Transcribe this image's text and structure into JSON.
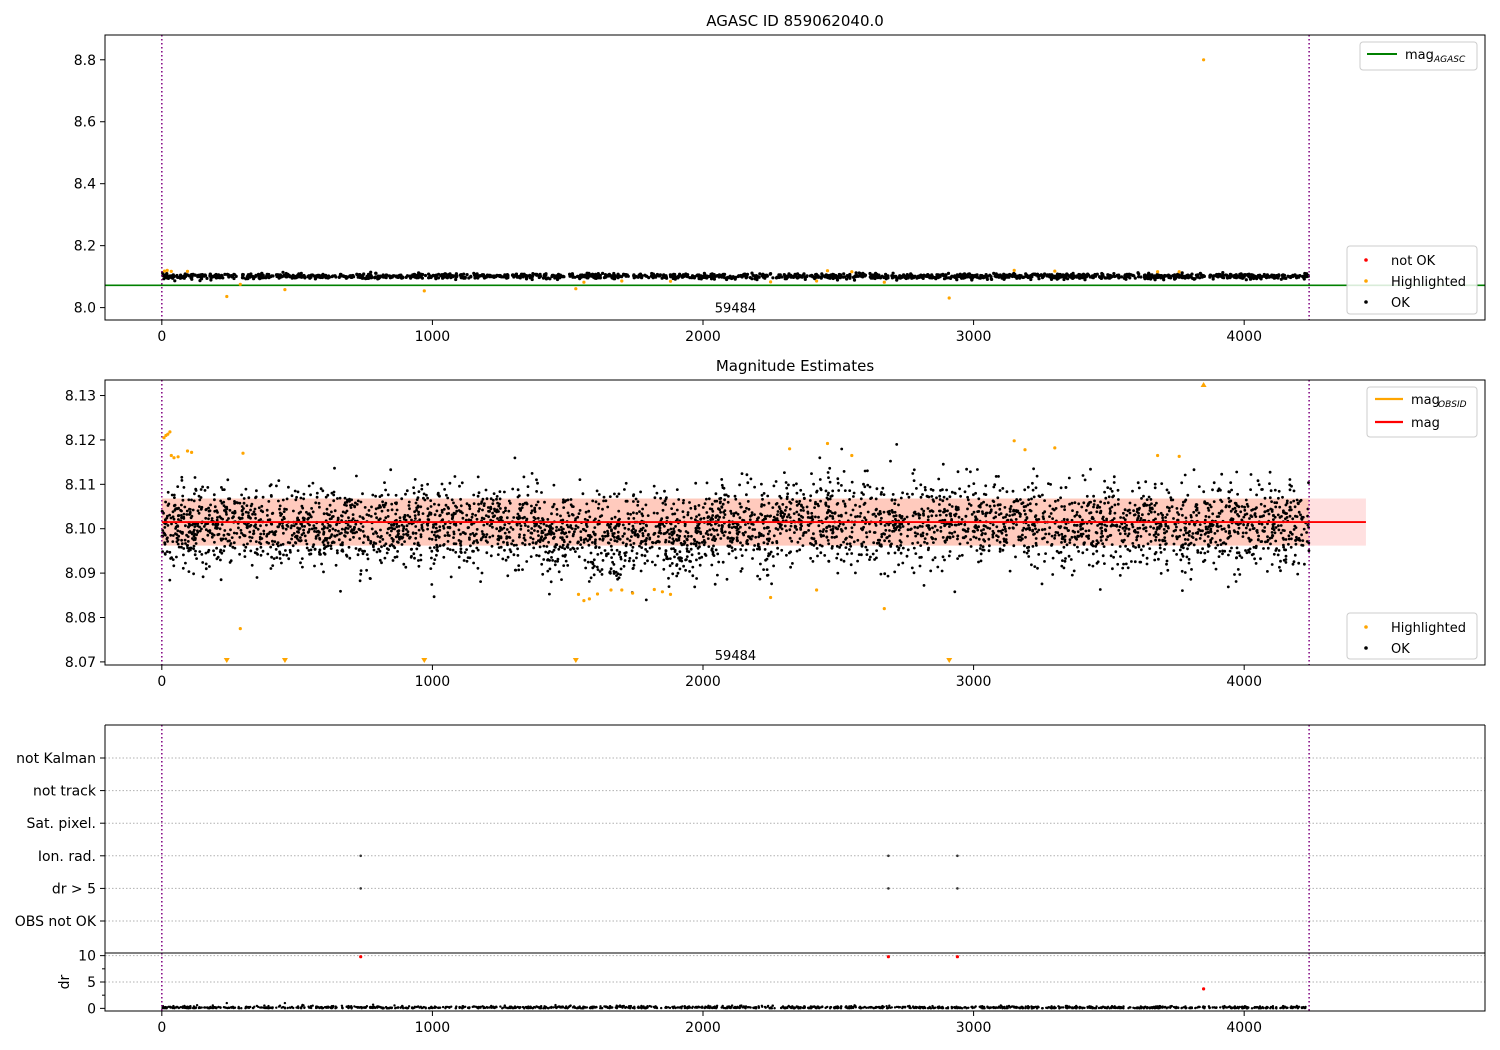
{
  "colors": {
    "ok": "#000000",
    "highlighted": "#ffa500",
    "not_ok": "#ff0000",
    "mag_agasc": "#008000",
    "mag_obsid": "#ffa500",
    "mag": "#ff0000",
    "obs_boundary": "#800080",
    "band_fill": "#ffcccc"
  },
  "chart_data": [
    {
      "type": "scatter",
      "title": "AGASC ID 859062040.0",
      "xlim": [
        -210,
        4890
      ],
      "ylim": [
        7.96,
        8.88
      ],
      "xticks": [
        0,
        1000,
        2000,
        3000,
        4000
      ],
      "yticks": [
        8.0,
        8.2,
        8.4,
        8.6,
        8.8
      ],
      "ytick_labels": [
        "8.0",
        "8.2",
        "8.4",
        "8.6",
        "8.8"
      ],
      "mag_agasc": 8.072,
      "obs_boundaries": [
        0,
        4240
      ],
      "obs_label": {
        "text": "59484",
        "x": 2120,
        "y": 8.0
      },
      "series_ok_band": {
        "x_start": 0,
        "x_end": 4240,
        "center": 8.101,
        "spread": 0.007
      },
      "highlighted_points": [
        [
          10,
          8.118
        ],
        [
          20,
          8.12
        ],
        [
          35,
          8.117
        ],
        [
          95,
          8.117
        ],
        [
          240,
          8.036
        ],
        [
          290,
          8.075
        ],
        [
          455,
          8.058
        ],
        [
          970,
          8.054
        ],
        [
          1530,
          8.061
        ],
        [
          1560,
          8.082
        ],
        [
          1700,
          8.086
        ],
        [
          1880,
          8.085
        ],
        [
          2250,
          8.083
        ],
        [
          2420,
          8.086
        ],
        [
          2460,
          8.119
        ],
        [
          2550,
          8.116
        ],
        [
          2670,
          8.082
        ],
        [
          2910,
          8.031
        ],
        [
          3150,
          8.12
        ],
        [
          3300,
          8.118
        ],
        [
          3680,
          8.116
        ],
        [
          3760,
          8.116
        ],
        [
          3850,
          8.8
        ]
      ],
      "legend_upper": {
        "position": "upper right",
        "entries": [
          {
            "label": "mag",
            "sub": "AGASC",
            "kind": "line",
            "color": "#008000"
          }
        ]
      },
      "legend_lower": {
        "position": "lower right",
        "entries": [
          {
            "label": "not OK",
            "kind": "dot",
            "color": "#ff0000"
          },
          {
            "label": "Highlighted",
            "kind": "dot",
            "color": "#ffa500"
          },
          {
            "label": "OK",
            "kind": "dot",
            "color": "#000000"
          }
        ]
      }
    },
    {
      "type": "scatter",
      "title": "Magnitude Estimates",
      "xlim": [
        -210,
        4890
      ],
      "ylim": [
        8.0693,
        8.1335
      ],
      "xticks": [
        0,
        1000,
        2000,
        3000,
        4000
      ],
      "yticks": [
        8.07,
        8.08,
        8.09,
        8.1,
        8.11,
        8.12,
        8.13
      ],
      "ytick_labels": [
        "8.07",
        "8.08",
        "8.09",
        "8.10",
        "8.11",
        "8.12",
        "8.13"
      ],
      "mag": 8.1015,
      "mag_band": [
        8.0962,
        8.1068
      ],
      "mag_band_x": [
        0,
        4450
      ],
      "obs_band": {
        "x_start": 0,
        "x_end": 4240,
        "low": 8.0962,
        "high": 8.1068
      },
      "obs_boundaries": [
        0,
        4240
      ],
      "obs_label": {
        "text": "59484",
        "x": 2120,
        "y": 8.0715
      },
      "series_ok_band": {
        "x_start": 0,
        "x_end": 4240,
        "center": 8.1005,
        "spread": 0.0055
      },
      "highlighted_points": [
        [
          8,
          8.1205
        ],
        [
          15,
          8.121
        ],
        [
          22,
          8.1213
        ],
        [
          30,
          8.1218
        ],
        [
          35,
          8.1165
        ],
        [
          45,
          8.116
        ],
        [
          60,
          8.1162
        ],
        [
          95,
          8.1175
        ],
        [
          110,
          8.1172
        ],
        [
          300,
          8.117
        ],
        [
          290,
          8.0775
        ],
        [
          1540,
          8.0852
        ],
        [
          1560,
          8.0838
        ],
        [
          1580,
          8.0842
        ],
        [
          1610,
          8.0853
        ],
        [
          1660,
          8.0862
        ],
        [
          1700,
          8.0862
        ],
        [
          1740,
          8.0855
        ],
        [
          1820,
          8.0863
        ],
        [
          1850,
          8.0858
        ],
        [
          1880,
          8.0852
        ],
        [
          2250,
          8.0845
        ],
        [
          2320,
          8.118
        ],
        [
          2420,
          8.0862
        ],
        [
          2460,
          8.1192
        ],
        [
          2550,
          8.1165
        ],
        [
          2670,
          8.082
        ],
        [
          3150,
          8.1198
        ],
        [
          3190,
          8.1178
        ],
        [
          3300,
          8.1182
        ],
        [
          3680,
          8.1165
        ],
        [
          3760,
          8.1163
        ]
      ],
      "clipped_low": [
        240,
        455,
        970,
        1530,
        2910
      ],
      "clipped_high": [
        3850
      ],
      "legend_upper": {
        "position": "upper right",
        "entries": [
          {
            "label": "mag",
            "sub": "OBSID",
            "kind": "line",
            "color": "#ffa500"
          },
          {
            "label": "mag",
            "sub": "",
            "kind": "line",
            "color": "#ff0000"
          }
        ]
      },
      "legend_lower": {
        "position": "lower right",
        "entries": [
          {
            "label": "Highlighted",
            "kind": "dot",
            "color": "#ffa500"
          },
          {
            "label": "OK",
            "kind": "dot",
            "color": "#000000"
          }
        ]
      }
    },
    {
      "type": "scatter",
      "title": "",
      "xlim": [
        -210,
        4890
      ],
      "categories": [
        "not Kalman",
        "not track",
        "Sat. pixel.",
        "Ion. rad.",
        "dr > 5",
        "OBS not OK"
      ],
      "flags": {
        "Ion. rad.": [
          735,
          2685,
          2940
        ],
        "dr > 5": [
          735,
          2685,
          2940
        ]
      },
      "obs_boundaries": [
        0,
        4240
      ]
    },
    {
      "type": "scatter",
      "title": "",
      "ylabel": "dr",
      "xlim": [
        -210,
        4890
      ],
      "ylim": [
        -0.5,
        10.5
      ],
      "xticks": [
        0,
        1000,
        2000,
        3000,
        4000
      ],
      "yticks": [
        0,
        5,
        10
      ],
      "ytick_labels": [
        "0",
        "5",
        "10"
      ],
      "threshold_lines": [
        5,
        10
      ],
      "red_points": [
        [
          735,
          9.8
        ],
        [
          2685,
          9.8
        ],
        [
          2940,
          9.8
        ],
        [
          3850,
          3.7
        ]
      ],
      "spikes": [
        [
          240,
          1.0
        ],
        [
          455,
          1.0
        ]
      ],
      "baseline": {
        "x_start": 0,
        "x_end": 4240,
        "mean": 0.15,
        "spread": 0.15
      },
      "obs_boundaries": [
        0,
        4240
      ]
    }
  ]
}
